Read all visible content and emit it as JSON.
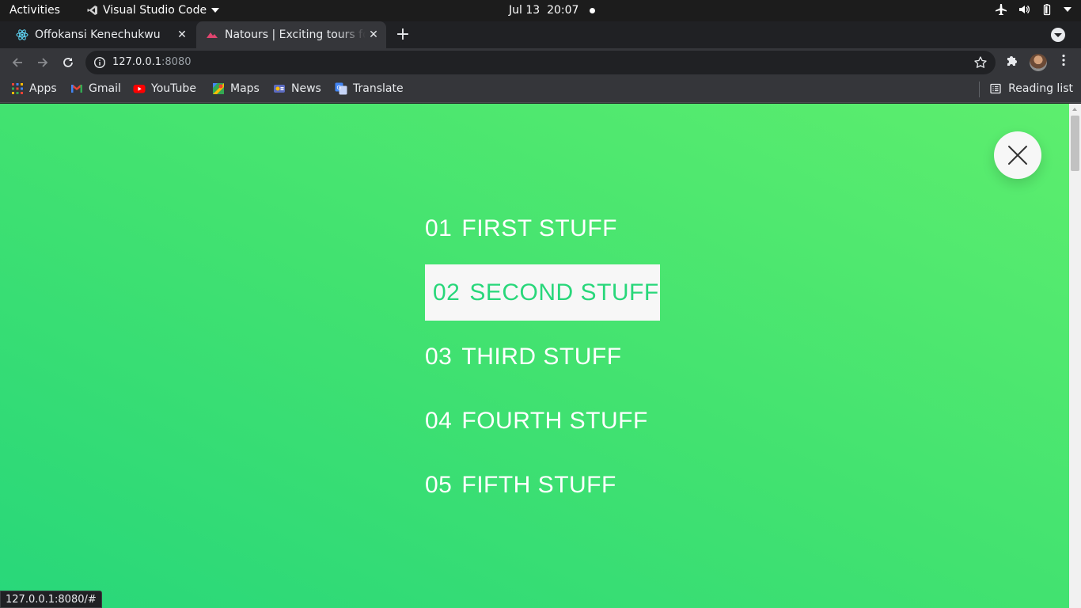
{
  "system_bar": {
    "activities": "Activities",
    "app_name": "Visual Studio Code",
    "date": "Jul 13",
    "time": "20:07"
  },
  "tabs": [
    {
      "title": "Offokansi Kenechukwu",
      "favicon": "react-icon"
    },
    {
      "title": "Natours | Exciting tours for adventurous people",
      "favicon": "natours-icon"
    }
  ],
  "address_bar": {
    "host": "127.0.0.1",
    "port": ":8080"
  },
  "bookmarks": [
    {
      "label": "Apps",
      "icon": "apps-grid-icon"
    },
    {
      "label": "Gmail",
      "icon": "gmail-icon"
    },
    {
      "label": "YouTube",
      "icon": "youtube-icon"
    },
    {
      "label": "Maps",
      "icon": "maps-icon"
    },
    {
      "label": "News",
      "icon": "news-icon"
    },
    {
      "label": "Translate",
      "icon": "translate-icon"
    }
  ],
  "reading_list": "Reading list",
  "navigation": {
    "items": [
      {
        "number": "01",
        "label": "FIRST STUFF"
      },
      {
        "number": "02",
        "label": "SECOND STUFF"
      },
      {
        "number": "03",
        "label": "THIRD STUFF"
      },
      {
        "number": "04",
        "label": "FOURTH STUFF"
      },
      {
        "number": "05",
        "label": "FIFTH STUFF"
      }
    ],
    "hovered_index": 1
  },
  "colors": {
    "gradient_start": "#28d77a",
    "gradient_end": "#5dee6e",
    "hover_bg": "#f7f7f7"
  },
  "status_url": "127.0.0.1:8080/#"
}
